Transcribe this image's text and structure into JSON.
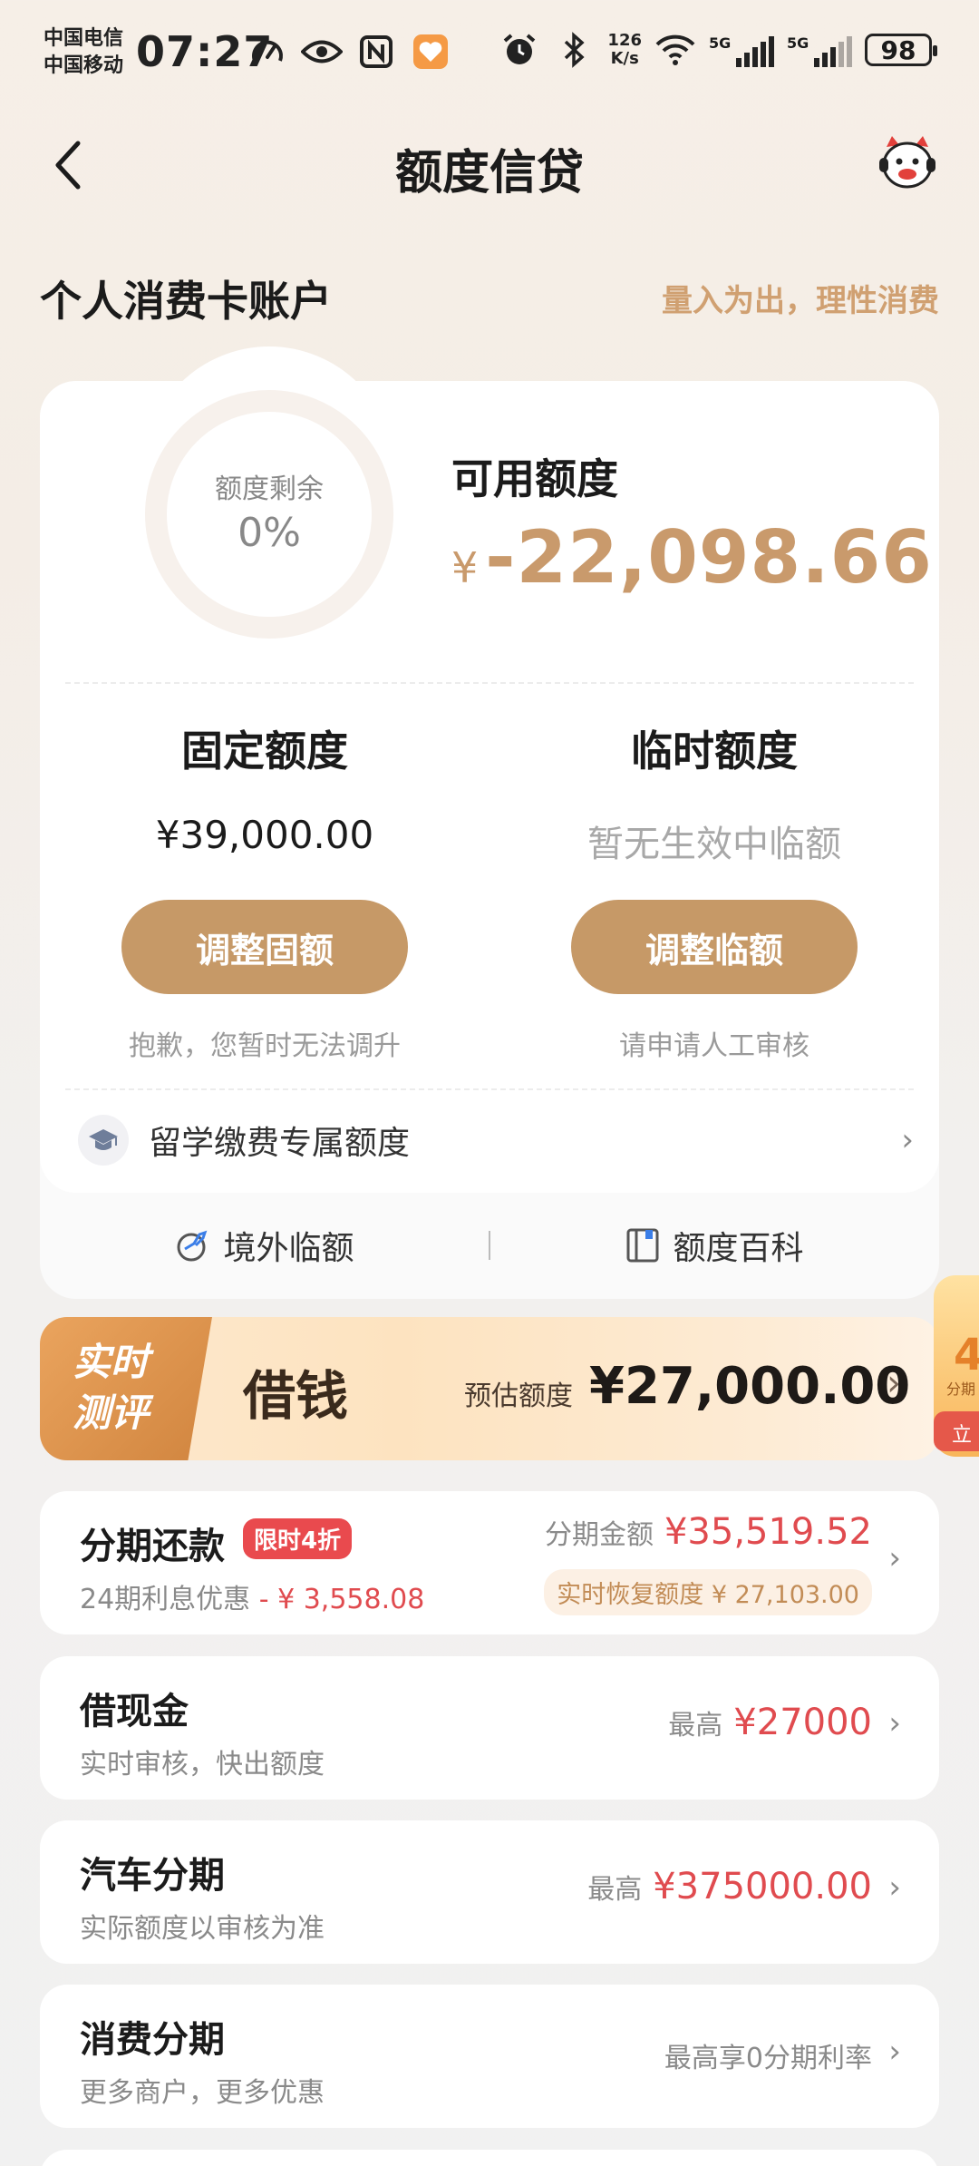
{
  "status_bar": {
    "carrier1": "中国电信",
    "carrier2": "中国移动",
    "time": "07:27",
    "net_speed_value": "126",
    "net_speed_unit": "K/s",
    "sig1_label": "5G",
    "sig2_label": "5G",
    "battery": "98"
  },
  "header": {
    "title": "额度信贷"
  },
  "section": {
    "title": "个人消费卡账户",
    "slogan": "量入为出，理性消费"
  },
  "credit": {
    "ring_label": "额度剩余",
    "ring_value": "0%",
    "available_label": "可用额度",
    "currency": "¥",
    "available_amount": "-22,098.66",
    "fixed_label": "固定额度",
    "fixed_value": "¥39,000.00",
    "fixed_button": "调整固额",
    "fixed_note": "抱歉，您暂时无法调升",
    "temp_label": "临时额度",
    "temp_value": "暂无生效中临额",
    "temp_button": "调整临额",
    "temp_note": "请申请人工审核",
    "study_label": "留学缴费专属额度",
    "overseas_label": "境外临额",
    "wiki_label": "额度百科",
    "chevron": "›"
  },
  "banner": {
    "tag_line1": "实时",
    "tag_line2": "测评",
    "main": "借钱",
    "estimate_label": "预估额度",
    "estimate_amount": "¥27,000.00",
    "chevron": "›",
    "float_num": "4",
    "float_sub": "分期",
    "float_btn": "立"
  },
  "rows": [
    {
      "title": "分期还款",
      "tag": "限时4折",
      "sub_prefix": "24期利息优惠",
      "sub_amount": "- ¥ 3,558.08",
      "right_label": "分期金额",
      "right_amount": "¥35,519.52",
      "recover_label": "实时恢复额度",
      "recover_amount": "¥ 27,103.00"
    },
    {
      "title": "借现金",
      "sub": "实时审核，快出额度",
      "right_label": "最高",
      "right_amount": "¥27000"
    },
    {
      "title": "汽车分期",
      "sub": "实际额度以审核为准",
      "right_label": "最高",
      "right_amount": "¥375000.00"
    },
    {
      "title": "消费分期",
      "sub": "更多商户，更多优惠",
      "right_label": "最高享0分期利率"
    }
  ],
  "colors": {
    "accent_gold": "#c69967",
    "amount_gold": "#c99a6c",
    "slogan_gold": "#d0a071",
    "red": "#e04b4f",
    "tag_red": "#e94a4e"
  }
}
